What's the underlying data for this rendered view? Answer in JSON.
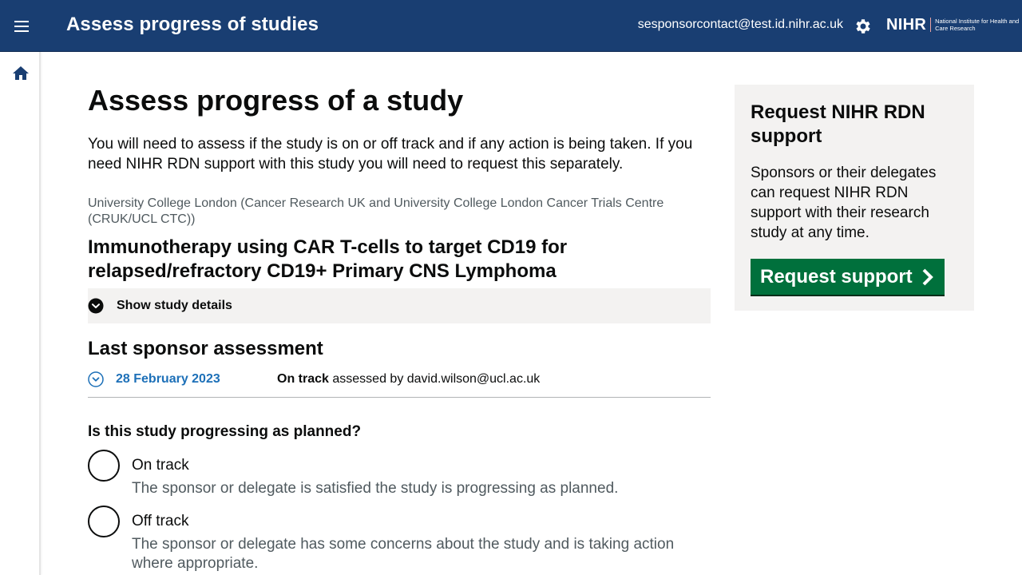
{
  "header": {
    "title": "Assess progress of studies",
    "user_email": "sesponsorcontact@test.id.nihr.ac.uk",
    "logo_mark": "NIHR",
    "logo_text": "National Institute for Health and Care Research",
    "menu_icon": "hamburger-menu-icon",
    "settings_icon": "gear-icon"
  },
  "sidebar": {
    "home_icon": "home-icon"
  },
  "main": {
    "page_title": "Assess progress of a study",
    "intro": "You will need to assess if the study is on or off track and if any action is being taken. If you need NIHR RDN support with this study you will need to request this separately.",
    "organisation": "University College London (Cancer Research UK and University College London Cancer Trials Centre (CRUK/UCL CTC))",
    "study_title": "Immunotherapy using CAR T-cells to target CD19 for relapsed/refractory CD19+ Primary CNS Lymphoma",
    "details_toggle_label": "Show study details",
    "last_assessment_heading": "Last sponsor assessment",
    "last_assessment": {
      "date": "28 February 2023",
      "status": "On track",
      "assessed_by_text": "assessed by david.wilson@ucl.ac.uk"
    },
    "question": "Is this study progressing as planned?",
    "options": [
      {
        "label": "On track",
        "hint": "The sponsor or delegate is satisfied the study is progressing as planned."
      },
      {
        "label": "Off track",
        "hint": "The sponsor or delegate has some concerns about the study and is taking action where appropriate."
      }
    ]
  },
  "aside": {
    "title": "Request NIHR RDN support",
    "text": "Sponsors or their delegates can request NIHR RDN support with their research study at any time.",
    "button_label": "Request support"
  },
  "colors": {
    "header_bg": "#193e72",
    "link": "#1d70b8",
    "button_green": "#00703c",
    "panel_bg": "#f3f2f1"
  }
}
